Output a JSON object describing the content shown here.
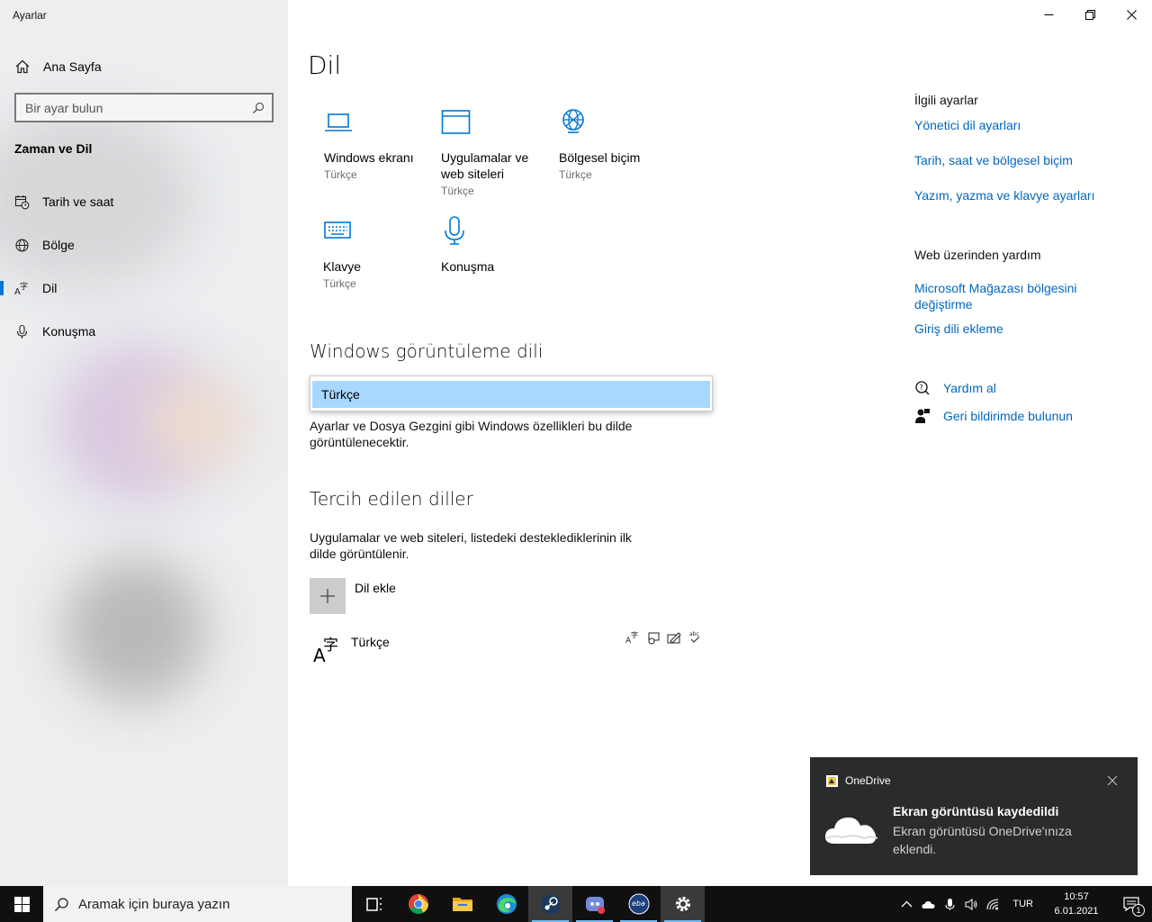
{
  "window": {
    "title": "Ayarlar"
  },
  "sidebar": {
    "home_label": "Ana Sayfa",
    "search_placeholder": "Bir ayar bulun",
    "section_title": "Zaman ve Dil",
    "items": [
      {
        "label": "Tarih ve saat",
        "icon": "calendar-clock-icon"
      },
      {
        "label": "Bölge",
        "icon": "globe-icon"
      },
      {
        "label": "Dil",
        "icon": "language-icon",
        "active": true
      },
      {
        "label": "Konuşma",
        "icon": "microphone-icon"
      }
    ]
  },
  "main": {
    "title": "Dil",
    "tiles": [
      {
        "label": "Windows ekranı",
        "sub": "Türkçe",
        "icon": "laptop-icon"
      },
      {
        "label": "Uygulamalar ve web siteleri",
        "sub": "Türkçe",
        "icon": "window-icon"
      },
      {
        "label": "Bölgesel biçim",
        "sub": "Türkçe",
        "icon": "regional-format-icon"
      },
      {
        "label": "Klavye",
        "sub": "Türkçe",
        "icon": "keyboard-icon"
      },
      {
        "label": "Konuşma",
        "sub": "",
        "icon": "microphone-icon"
      }
    ],
    "display_language": {
      "heading": "Windows görüntüleme dili",
      "selected": "Türkçe",
      "description": "Ayarlar ve Dosya Gezgini gibi Windows özellikleri bu dilde görüntülenecektir."
    },
    "preferred": {
      "heading": "Tercih edilen diller",
      "description": "Uygulamalar ve web siteleri, listedeki desteklediklerinin ilk dilde görüntülenir.",
      "add_label": "Dil ekle",
      "languages": [
        {
          "name": "Türkçe"
        }
      ]
    }
  },
  "related": {
    "title": "İlgili ayarlar",
    "links": [
      "Yönetici dil ayarları",
      "Tarih, saat ve bölgesel biçim",
      "Yazım, yazma ve klavye ayarları"
    ]
  },
  "web_help": {
    "title": "Web üzerinden yardım",
    "links": [
      "Microsoft Mağazası bölgesini değiştirme",
      "Giriş dili ekleme"
    ]
  },
  "help": {
    "get_help": "Yardım al",
    "feedback": "Geri bildirimde bulunun"
  },
  "toast": {
    "app": "OneDrive",
    "title": "Ekran görüntüsü kaydedildi",
    "body": "Ekran görüntüsü OneDrive'ınıza eklendi."
  },
  "taskbar": {
    "search_placeholder": "Aramak için buraya yazın",
    "apps": [
      "task-view-icon",
      "chrome-icon",
      "file-explorer-icon",
      "edge-icon",
      "steam-icon",
      "discord-icon",
      "eba-icon",
      "settings-icon"
    ],
    "language": "TUR",
    "time": "10:57",
    "date": "6.01.2021",
    "notification_count": "1"
  },
  "colors": {
    "accent": "#0078d7",
    "link": "#0067c0",
    "selection": "#a9d8fe",
    "taskbar": "#101010"
  }
}
